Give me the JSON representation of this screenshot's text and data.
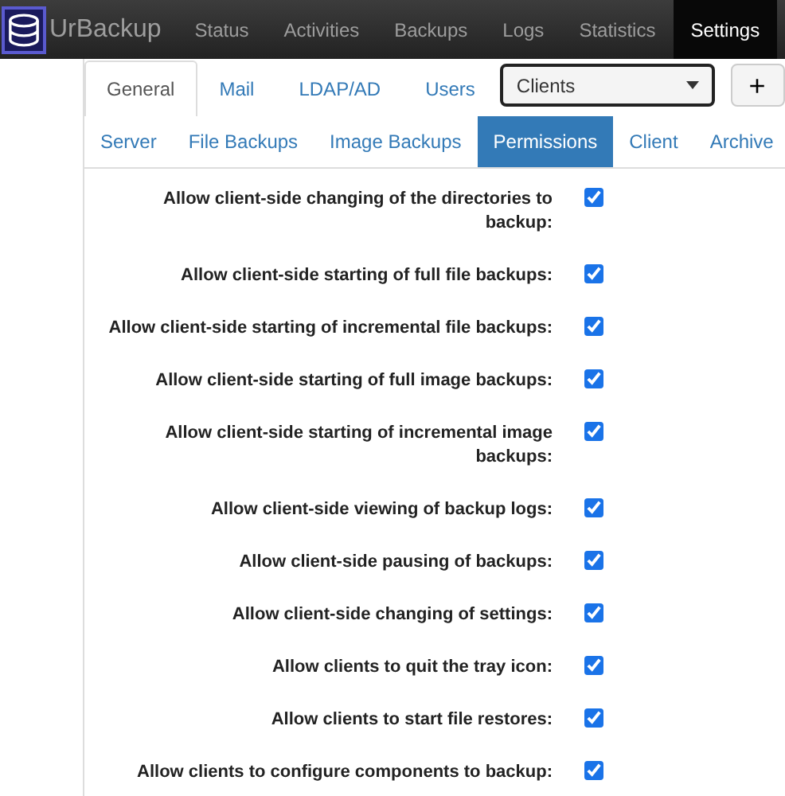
{
  "navbar": {
    "brand": "UrBackup",
    "items": [
      {
        "label": "Status",
        "selected": false
      },
      {
        "label": "Activities",
        "selected": false
      },
      {
        "label": "Backups",
        "selected": false
      },
      {
        "label": "Logs",
        "selected": false
      },
      {
        "label": "Statistics",
        "selected": false
      },
      {
        "label": "Settings",
        "selected": true
      }
    ]
  },
  "tabs": [
    {
      "label": "General",
      "selected": true
    },
    {
      "label": "Mail",
      "selected": false
    },
    {
      "label": "LDAP/AD",
      "selected": false
    },
    {
      "label": "Users",
      "selected": false
    }
  ],
  "client_select": {
    "value": "Clients"
  },
  "add_button": {
    "label": "+"
  },
  "subtabs": [
    {
      "label": "Server",
      "selected": false
    },
    {
      "label": "File Backups",
      "selected": false
    },
    {
      "label": "Image Backups",
      "selected": false
    },
    {
      "label": "Permissions",
      "selected": true
    },
    {
      "label": "Client",
      "selected": false
    },
    {
      "label": "Archive",
      "selected": false
    }
  ],
  "permissions": [
    {
      "label": "Allow client-side changing of the directories to backup:",
      "checked": true
    },
    {
      "label": "Allow client-side starting of full file backups:",
      "checked": true
    },
    {
      "label": "Allow client-side starting of incremental file backups:",
      "checked": true
    },
    {
      "label": "Allow client-side starting of full image backups:",
      "checked": true
    },
    {
      "label": "Allow client-side starting of incremental image backups:",
      "checked": true
    },
    {
      "label": "Allow client-side viewing of backup logs:",
      "checked": true
    },
    {
      "label": "Allow client-side pausing of backups:",
      "checked": true
    },
    {
      "label": "Allow client-side changing of settings:",
      "checked": true
    },
    {
      "label": "Allow clients to quit the tray icon:",
      "checked": true
    },
    {
      "label": "Allow clients to start file restores:",
      "checked": true
    },
    {
      "label": "Allow clients to configure components to backup:",
      "checked": true
    }
  ]
}
